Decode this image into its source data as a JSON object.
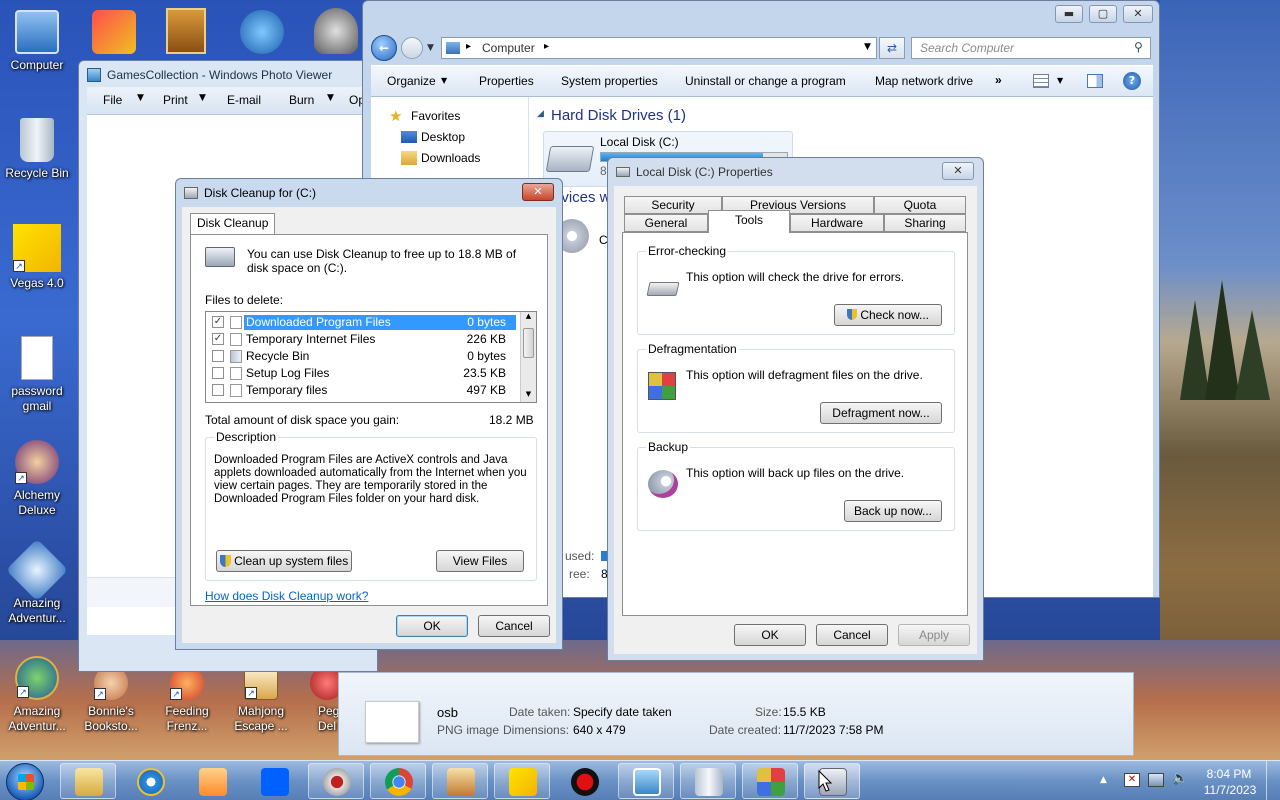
{
  "desktop": {
    "icons": [
      {
        "label": "Computer"
      },
      {
        "label": "Recycle Bin"
      },
      {
        "label": "Vegas 4.0"
      },
      {
        "label": "password gmail"
      },
      {
        "label": "Alchemy Deluxe"
      },
      {
        "label": "Amazing Adventur..."
      },
      {
        "label": "Amazing Adventur..."
      },
      {
        "label": "Bonnie's Booksto..."
      },
      {
        "label": "Feeding Frenz..."
      },
      {
        "label": "Mahjong Escape ..."
      },
      {
        "label": "Peg Del"
      }
    ]
  },
  "photo_viewer": {
    "title": "GamesCollection - Windows Photo Viewer",
    "menu": [
      "File",
      "Print",
      "E-mail",
      "Burn",
      "Op"
    ]
  },
  "explorer": {
    "address": "Computer",
    "search_placeholder": "Search Computer",
    "toolbar": [
      "Organize",
      "Properties",
      "System properties",
      "Uninstall or change a program",
      "Map network drive",
      "»"
    ],
    "nav": [
      "Favorites",
      "Desktop",
      "Downloads"
    ],
    "section_title": "Hard Disk Drives (1)",
    "drive_name": "Local Disk (C:)",
    "drive_fill_percent": 87,
    "devices_partial": "evices w",
    "used_label": "used:",
    "free_label": "ree:",
    "free_partial": "8",
    "drive_sub_partial": "8",
    "device_letter_partial": "C",
    "details": {
      "name": "osb",
      "type": "PNG image",
      "date_taken_label": "Date taken:",
      "date_taken_value": "Specify date taken",
      "dimensions_label": "Dimensions:",
      "dimensions_value": "640 x 479",
      "size_label": "Size:",
      "size_value": "15.5 KB",
      "date_created_label": "Date created:",
      "date_created_value": "11/7/2023 7:58 PM"
    }
  },
  "disk_cleanup": {
    "title": "Disk Cleanup for  (C:)",
    "tab": "Disk Cleanup",
    "intro": "You can use Disk Cleanup to free up to 18.8 MB of disk space on  (C:).",
    "files_to_delete_label": "Files to delete:",
    "files": [
      {
        "name": "Downloaded Program Files",
        "size": "0 bytes",
        "checked": true,
        "selected": true
      },
      {
        "name": "Temporary Internet Files",
        "size": "226 KB",
        "checked": true,
        "selected": false
      },
      {
        "name": "Recycle Bin",
        "size": "0 bytes",
        "checked": false,
        "selected": false
      },
      {
        "name": "Setup Log Files",
        "size": "23.5 KB",
        "checked": false,
        "selected": false
      },
      {
        "name": "Temporary files",
        "size": "497 KB",
        "checked": false,
        "selected": false
      }
    ],
    "total_label": "Total amount of disk space you gain:",
    "total_value": "18.2 MB",
    "description_title": "Description",
    "description": "Downloaded Program Files are ActiveX controls and Java applets downloaded automatically from the Internet when you view certain pages. They are temporarily stored in the Downloaded Program Files folder on your hard disk.",
    "cleanup_system_label": "Clean up system files",
    "view_files_label": "View Files",
    "help_link": "How does Disk Cleanup work?",
    "ok_label": "OK",
    "cancel_label": "Cancel"
  },
  "properties": {
    "title": "Local Disk (C:) Properties",
    "tabs_row1": [
      "Security",
      "Previous Versions",
      "Quota"
    ],
    "tabs_row2": [
      "General",
      "Tools",
      "Hardware",
      "Sharing"
    ],
    "active_tab": "Tools",
    "error_checking": {
      "title": "Error-checking",
      "text": "This option will check the drive for errors.",
      "button": "Check now..."
    },
    "defrag": {
      "title": "Defragmentation",
      "text": "This option will defragment files on the drive.",
      "button": "Defragment now..."
    },
    "backup": {
      "title": "Backup",
      "text": "This option will back up files on the drive.",
      "button": "Back up now..."
    },
    "ok_label": "OK",
    "cancel_label": "Cancel",
    "apply_label": "Apply"
  },
  "taskbar": {
    "time": "8:04 PM",
    "date": "11/7/2023"
  }
}
